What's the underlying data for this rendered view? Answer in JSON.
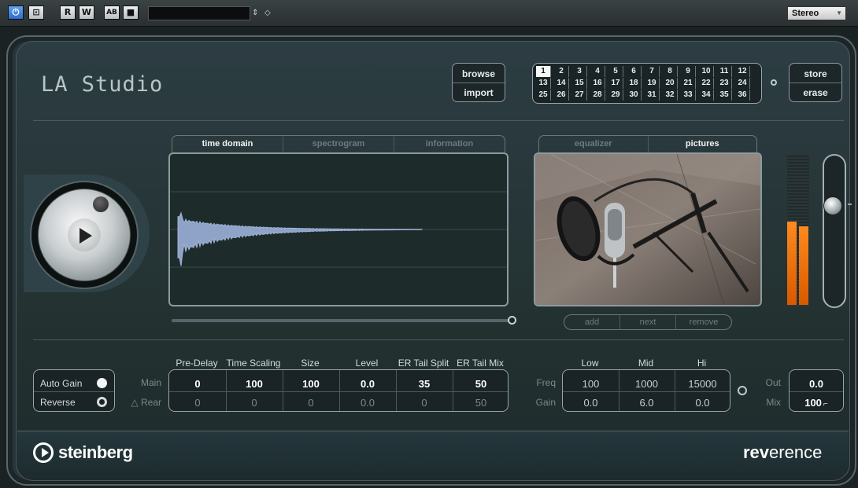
{
  "toolbar": {
    "buttons": [
      {
        "icon": "power-icon",
        "glyph": "⏻"
      },
      {
        "icon": "bypass-icon",
        "glyph": "⊡"
      },
      {
        "label": "R"
      },
      {
        "label": "W"
      },
      {
        "label": "AB"
      },
      {
        "icon": "settings-icon",
        "glyph": "■"
      }
    ],
    "preset_arrows": "⇕",
    "preset_icon": "◇",
    "output_select": "Stereo"
  },
  "plugin": {
    "program_name": "LA Studio",
    "browse_label": "browse",
    "import_label": "import",
    "store_label": "store",
    "erase_label": "erase",
    "presets": [
      "1",
      "2",
      "3",
      "4",
      "5",
      "6",
      "7",
      "8",
      "9",
      "10",
      "11",
      "12",
      "13",
      "14",
      "15",
      "16",
      "17",
      "18",
      "19",
      "20",
      "21",
      "22",
      "23",
      "24",
      "25",
      "26",
      "27",
      "28",
      "29",
      "30",
      "31",
      "32",
      "33",
      "34",
      "35",
      "36"
    ],
    "selected_preset": "1"
  },
  "impulse_tabs": [
    "time domain",
    "spectrogram",
    "information"
  ],
  "picture_tabs": [
    "equalizer",
    "pictures"
  ],
  "picture_buttons": [
    "add",
    "next",
    "remove"
  ],
  "options": {
    "auto_gain_label": "Auto Gain",
    "reverse_label": "Reverse"
  },
  "params": {
    "row_labels": [
      "Main",
      "Rear"
    ],
    "rear_icon": "△",
    "headers": [
      "Pre-Delay",
      "Time Scaling",
      "Size",
      "Level",
      "ER Tail Split",
      "ER Tail Mix"
    ],
    "main": [
      "0",
      "100",
      "100",
      "0.0",
      "35",
      "50"
    ],
    "rear": [
      "0",
      "0",
      "0",
      "0.0",
      "0",
      "50"
    ]
  },
  "eq": {
    "headers": [
      "Low",
      "Mid",
      "Hi"
    ],
    "row_labels": [
      "Freq",
      "Gain"
    ],
    "freq": [
      "100",
      "1000",
      "15000"
    ],
    "gain": [
      "0.0",
      "6.0",
      "0.0"
    ]
  },
  "output": {
    "out_label": "Out",
    "mix_label": "Mix",
    "out_value": "0.0",
    "mix_value": "100"
  },
  "branding": {
    "brand": "steinberg",
    "product_bold": "rev",
    "product_rest": "erence"
  },
  "colors": {
    "meter": "#ff8a1d",
    "panel": "#27363b"
  }
}
